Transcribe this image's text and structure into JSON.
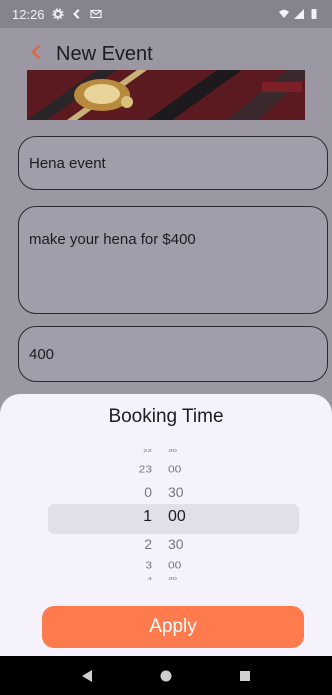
{
  "status_bar": {
    "time": "12:26",
    "icons": [
      "gear-icon",
      "flutter-icon",
      "mail-icon"
    ],
    "right_icons": [
      "wifi-icon",
      "signal-icon",
      "battery-icon"
    ]
  },
  "app_bar": {
    "title": "New Event",
    "back_icon": "chevron-left-icon"
  },
  "banner": {
    "alt": "event-banner-image"
  },
  "form": {
    "name_value": "Hena event",
    "description_value": "make your hena for $400",
    "price_value": "400"
  },
  "sheet": {
    "title": "Booking Time",
    "picker_rows": [
      {
        "hour": "22",
        "minute": "30"
      },
      {
        "hour": "23",
        "minute": "00"
      },
      {
        "hour": "0",
        "minute": "30"
      },
      {
        "hour": "1",
        "minute": "00"
      },
      {
        "hour": "2",
        "minute": "30"
      },
      {
        "hour": "3",
        "minute": "00"
      },
      {
        "hour": "4",
        "minute": "30"
      }
    ],
    "apply_label": "Apply"
  },
  "colors": {
    "accent": "#ff7a4d",
    "sheet_bg": "#f6f2fb",
    "scrim": "#9b97a3"
  },
  "nav_bar": {
    "icons": [
      "back-triangle-icon",
      "home-circle-icon",
      "recents-square-icon"
    ]
  }
}
